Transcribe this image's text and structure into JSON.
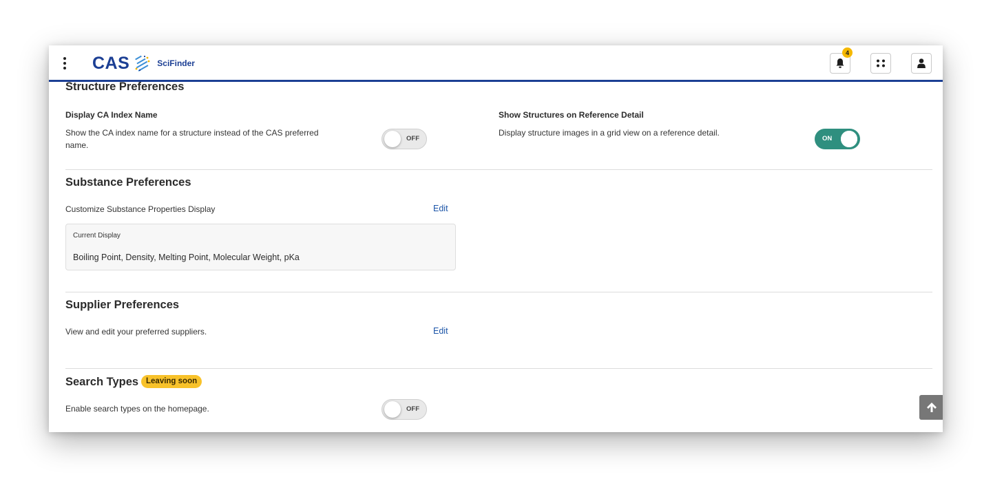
{
  "header": {
    "logo_text": "CAS",
    "product_name": "SciFinder",
    "notification_count": "4"
  },
  "structure": {
    "title": "Structure Preferences",
    "ca_index": {
      "label": "Display CA Index Name",
      "description": "Show the CA index name for a structure instead of the CAS preferred name.",
      "toggle_state": "OFF"
    },
    "show_structures": {
      "label": "Show Structures on Reference Detail",
      "description": "Display structure images in a grid view on a reference detail.",
      "toggle_state": "ON"
    }
  },
  "substance": {
    "title": "Substance Preferences",
    "customize_label": "Customize Substance Properties Display",
    "edit_label": "Edit",
    "current_display_caption": "Current Display",
    "current_display_value": "Boiling Point, Density, Melting Point, Molecular Weight, pKa"
  },
  "supplier": {
    "title": "Supplier Preferences",
    "description": "View and edit your preferred suppliers.",
    "edit_label": "Edit"
  },
  "search_types": {
    "title": "Search Types",
    "badge": "Leaving soon",
    "description": "Enable search types on the homepage.",
    "toggle_state": "OFF"
  },
  "colors": {
    "brand_blue": "#1c3f94",
    "toggle_on": "#2f8f7f",
    "badge_yellow": "#f8c22a",
    "link_blue": "#1c55a8"
  },
  "icons": [
    "kebab-menu-icon",
    "cas-logo-icon",
    "bell-icon",
    "apps-grid-icon",
    "user-icon",
    "arrow-up-icon"
  ]
}
